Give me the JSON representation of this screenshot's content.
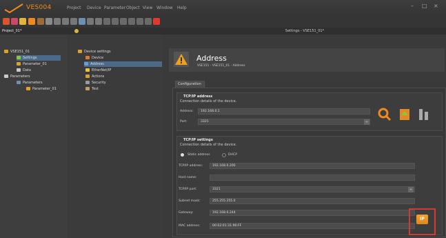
{
  "app": {
    "title": "VES004",
    "window_buttons": [
      "–",
      "□",
      "×"
    ]
  },
  "menu": [
    "Project",
    "Device",
    "Parameter",
    "Object",
    "View",
    "Window",
    "Help"
  ],
  "project_panel": {
    "title": "Project_01*",
    "tree": [
      {
        "label": "VSE151_01",
        "level": 0
      },
      {
        "label": "Settings",
        "level": 1,
        "selected": true
      },
      {
        "label": "Parameter_01",
        "level": 1
      },
      {
        "label": "Data",
        "level": 1
      },
      {
        "label": "Parameters",
        "level": 0
      },
      {
        "label": "Parameters",
        "level": 1
      },
      {
        "label": "Parameter_01",
        "level": 2
      }
    ]
  },
  "device_tree": {
    "items": [
      {
        "label": "Device settings",
        "level": 0
      },
      {
        "label": "Device",
        "level": 1
      },
      {
        "label": "Address",
        "level": 1,
        "selected": true
      },
      {
        "label": "EtherNet/IP",
        "level": 1
      },
      {
        "label": "Actions",
        "level": 1
      },
      {
        "label": "Security",
        "level": 1
      },
      {
        "label": "Test",
        "level": 1
      }
    ]
  },
  "settings": {
    "window_title": "Settings - VSE151_01*",
    "header_title": "Address",
    "header_subtitle": "VSE151 - VSE151_01 - Address",
    "tab": "Configuration",
    "tcpip_address": {
      "title": "TCP/IP address",
      "subtitle": "Connection details of the device.",
      "address_label": "Address:",
      "address_value": "192.168.0.1",
      "port_label": "Port:",
      "port_value": "3321"
    },
    "tcpip_settings": {
      "title": "TCP/IP settings",
      "subtitle": "Connection details of the device.",
      "radio_static": "Static address",
      "radio_dhcp": "DHCP",
      "fields": [
        {
          "label": "TCP/IP address:",
          "value": "192.168.0.200"
        },
        {
          "label": "Host name:",
          "value": ""
        },
        {
          "label": "TCP/IP port:",
          "value": "3321"
        },
        {
          "label": "Subnet mask:",
          "value": "255.255.255.0"
        },
        {
          "label": "Gateway:",
          "value": "192.168.0.244"
        },
        {
          "label": "MAC address:",
          "value": "00:02:01:31:90:FF"
        }
      ]
    },
    "ip_button_label": "IP"
  },
  "colors": {
    "accent": "#f08a1e",
    "highlight": "#d23a32",
    "selection": "#4b6a8a"
  }
}
